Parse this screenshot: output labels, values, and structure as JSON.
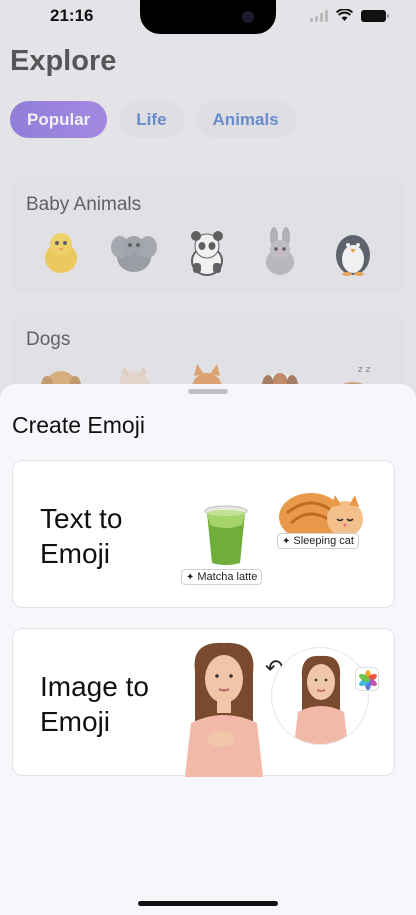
{
  "status": {
    "time": "21:16"
  },
  "explore": {
    "title": "Explore",
    "tabs": [
      {
        "label": "Popular",
        "active": true
      },
      {
        "label": "Life",
        "active": false
      },
      {
        "label": "Animals",
        "active": false
      }
    ],
    "sections": [
      {
        "title": "Baby Animals",
        "items": [
          "chick",
          "elephant",
          "panda",
          "rabbit",
          "penguin"
        ]
      },
      {
        "title": "Dogs",
        "items": [
          "golden-retriever",
          "puppy",
          "corgi",
          "beagle",
          "sleeping-dog"
        ]
      }
    ]
  },
  "sheet": {
    "title": "Create Emoji",
    "text_to_emoji": {
      "label_line1": "Text to",
      "label_line2": "Emoji",
      "chip1": "Matcha latte",
      "chip2": "Sleeping cat"
    },
    "image_to_emoji": {
      "label_line1": "Image to",
      "label_line2": "Emoji"
    }
  },
  "colors": {
    "accent_start": "#6b4fd6",
    "accent_end": "#8a5fe6",
    "tab_text": "#2a65c2"
  }
}
